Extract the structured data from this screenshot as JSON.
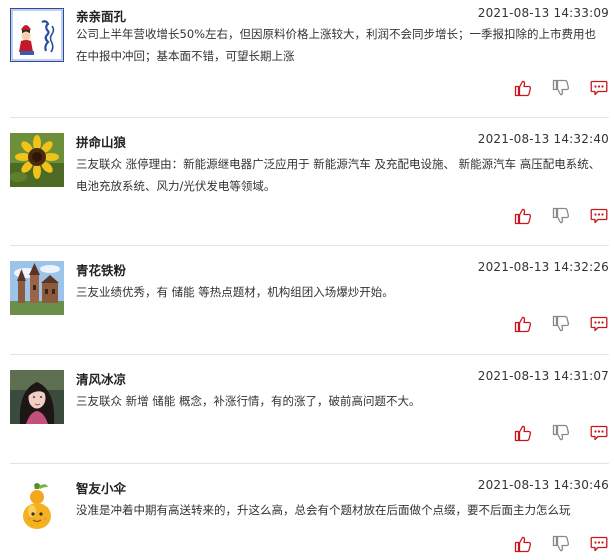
{
  "posts": [
    {
      "username": "亲亲面孔",
      "time": "2021-08-13 14:33:09",
      "content": [
        "公司上半年营收增长50%左右，但因原料价格上涨较大，利润不会同步增长；一季报扣除的上市费用也在中报中冲回；基本面不错，可望长期上涨"
      ],
      "avatar": "mongolian-figure-avatar"
    },
    {
      "username": "拼命山狼",
      "time": "2021-08-13 14:32:40",
      "content": [
        "三友联众 涨停理由：新能源继电器广泛应用于 新能源汽车 及充配电设施、 新能源汽车 高压配电系统、电池充放系统、风力/光伏发电等领域。"
      ],
      "avatar": "sunflower-avatar"
    },
    {
      "username": "青花铁粉",
      "time": "2021-08-13 14:32:26",
      "content": [
        "三友业绩优秀，有 储能 等热点题材，机构组团入场爆炒开始。"
      ],
      "avatar": "castle-avatar"
    },
    {
      "username": "清风冰凉",
      "time": "2021-08-13 14:31:07",
      "content": [
        "三友联众 新增 储能 概念，补涨行情，有的涨了，破前高问题不大。"
      ],
      "avatar": "portrait-avatar"
    },
    {
      "username": "智友小伞",
      "time": "2021-08-13 14:30:46",
      "content": [
        "没准是冲着中期有高送转来的，升这么高，总会有个题材放在后面做个点缀，要不后面主力怎么玩"
      ],
      "avatar": "gourd-avatar"
    }
  ],
  "icons": {
    "like": "thumbs-up-icon",
    "dislike": "thumbs-down-icon",
    "comment": "comment-icon"
  },
  "colors": {
    "accent": "#c8161e",
    "grey_icon": "#888888",
    "divider": "#e4e4e4"
  }
}
